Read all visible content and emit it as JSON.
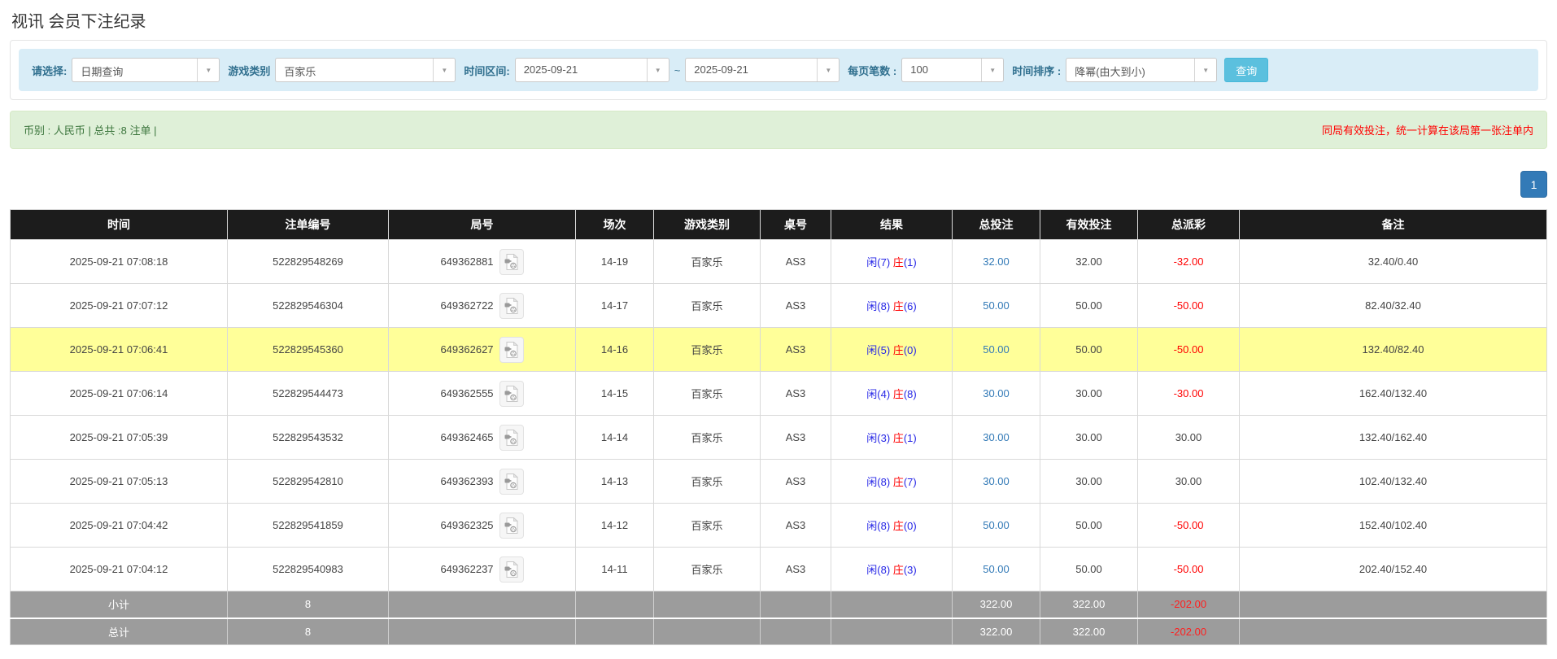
{
  "page": {
    "title": "视讯 会员下注纪录"
  },
  "filters": {
    "mode_label": "请选择:",
    "mode_value": "日期查询",
    "game_type_label": "游戏类别",
    "game_type_value": "百家乐",
    "time_range_label": "时间区间:",
    "date_from": "2025-09-21",
    "tilde": "~",
    "date_to": "2025-09-21",
    "per_page_label": "每页笔数 :",
    "per_page_value": "100",
    "sort_label": "时间排序 :",
    "sort_value": "降幂(由大到小)",
    "search_button": "查询",
    "caret": "▼"
  },
  "summary": {
    "left": "币别 : 人民币 | 总共 :8 注单 |",
    "right_notice": "同局有效投注，统一计算在该局第一张注单内"
  },
  "pagination": {
    "current": "1"
  },
  "table": {
    "headers": [
      "时间",
      "注单编号",
      "局号",
      "场次",
      "游戏类别",
      "桌号",
      "结果",
      "总投注",
      "有效投注",
      "总派彩",
      "备注"
    ],
    "rows": [
      {
        "time": "2025-09-21 07:08:18",
        "bet_id": "522829548269",
        "round_id": "649362881",
        "session": "14-19",
        "game": "百家乐",
        "table_id": "AS3",
        "result_player": "闲(7)",
        "result_banker": "庄",
        "result_banker_pts": "(1)",
        "total_bet": "32.00",
        "valid_bet": "32.00",
        "payout": "-32.00",
        "remark": "32.40/0.40",
        "highlight": false
      },
      {
        "time": "2025-09-21 07:07:12",
        "bet_id": "522829546304",
        "round_id": "649362722",
        "session": "14-17",
        "game": "百家乐",
        "table_id": "AS3",
        "result_player": "闲(8)",
        "result_banker": "庄",
        "result_banker_pts": "(6)",
        "total_bet": "50.00",
        "valid_bet": "50.00",
        "payout": "-50.00",
        "remark": "82.40/32.40",
        "highlight": false
      },
      {
        "time": "2025-09-21 07:06:41",
        "bet_id": "522829545360",
        "round_id": "649362627",
        "session": "14-16",
        "game": "百家乐",
        "table_id": "AS3",
        "result_player": "闲(5)",
        "result_banker": "庄",
        "result_banker_pts": "(0)",
        "total_bet": "50.00",
        "valid_bet": "50.00",
        "payout": "-50.00",
        "remark": "132.40/82.40",
        "highlight": true
      },
      {
        "time": "2025-09-21 07:06:14",
        "bet_id": "522829544473",
        "round_id": "649362555",
        "session": "14-15",
        "game": "百家乐",
        "table_id": "AS3",
        "result_player": "闲(4)",
        "result_banker": "庄",
        "result_banker_pts": "(8)",
        "total_bet": "30.00",
        "valid_bet": "30.00",
        "payout": "-30.00",
        "remark": "162.40/132.40",
        "highlight": false
      },
      {
        "time": "2025-09-21 07:05:39",
        "bet_id": "522829543532",
        "round_id": "649362465",
        "session": "14-14",
        "game": "百家乐",
        "table_id": "AS3",
        "result_player": "闲(3)",
        "result_banker": "庄",
        "result_banker_pts": "(1)",
        "total_bet": "30.00",
        "valid_bet": "30.00",
        "payout": "30.00",
        "remark": "132.40/162.40",
        "highlight": false
      },
      {
        "time": "2025-09-21 07:05:13",
        "bet_id": "522829542810",
        "round_id": "649362393",
        "session": "14-13",
        "game": "百家乐",
        "table_id": "AS3",
        "result_player": "闲(8)",
        "result_banker": "庄",
        "result_banker_pts": "(7)",
        "total_bet": "30.00",
        "valid_bet": "30.00",
        "payout": "30.00",
        "remark": "102.40/132.40",
        "highlight": false
      },
      {
        "time": "2025-09-21 07:04:42",
        "bet_id": "522829541859",
        "round_id": "649362325",
        "session": "14-12",
        "game": "百家乐",
        "table_id": "AS3",
        "result_player": "闲(8)",
        "result_banker": "庄",
        "result_banker_pts": "(0)",
        "total_bet": "50.00",
        "valid_bet": "50.00",
        "payout": "-50.00",
        "remark": "152.40/102.40",
        "highlight": false
      },
      {
        "time": "2025-09-21 07:04:12",
        "bet_id": "522829540983",
        "round_id": "649362237",
        "session": "14-11",
        "game": "百家乐",
        "table_id": "AS3",
        "result_player": "闲(8)",
        "result_banker": "庄",
        "result_banker_pts": "(3)",
        "total_bet": "50.00",
        "valid_bet": "50.00",
        "payout": "-50.00",
        "remark": "202.40/152.40",
        "highlight": false
      }
    ],
    "subtotal": {
      "label": "小计",
      "count": "8",
      "total_bet": "322.00",
      "valid_bet": "322.00",
      "payout": "-202.00"
    },
    "total": {
      "label": "总计",
      "count": "8",
      "total_bet": "322.00",
      "valid_bet": "322.00",
      "payout": "-202.00"
    }
  },
  "colors": {
    "filter_bg": "#d9edf7",
    "filter_label": "#31708f",
    "summary_bg": "#dff0d8",
    "summary_text": "#3c763d",
    "notice_red": "#ff0000",
    "header_bg": "#1c1c1c",
    "highlight_yellow": "#ffff99",
    "subtotal_gray": "#9c9c9c",
    "amount_blue": "#337ab7",
    "result_blue": "#2626e6",
    "result_red": "#ff0000",
    "search_button_bg": "#5bc0de",
    "pager_blue": "#337ab7"
  }
}
